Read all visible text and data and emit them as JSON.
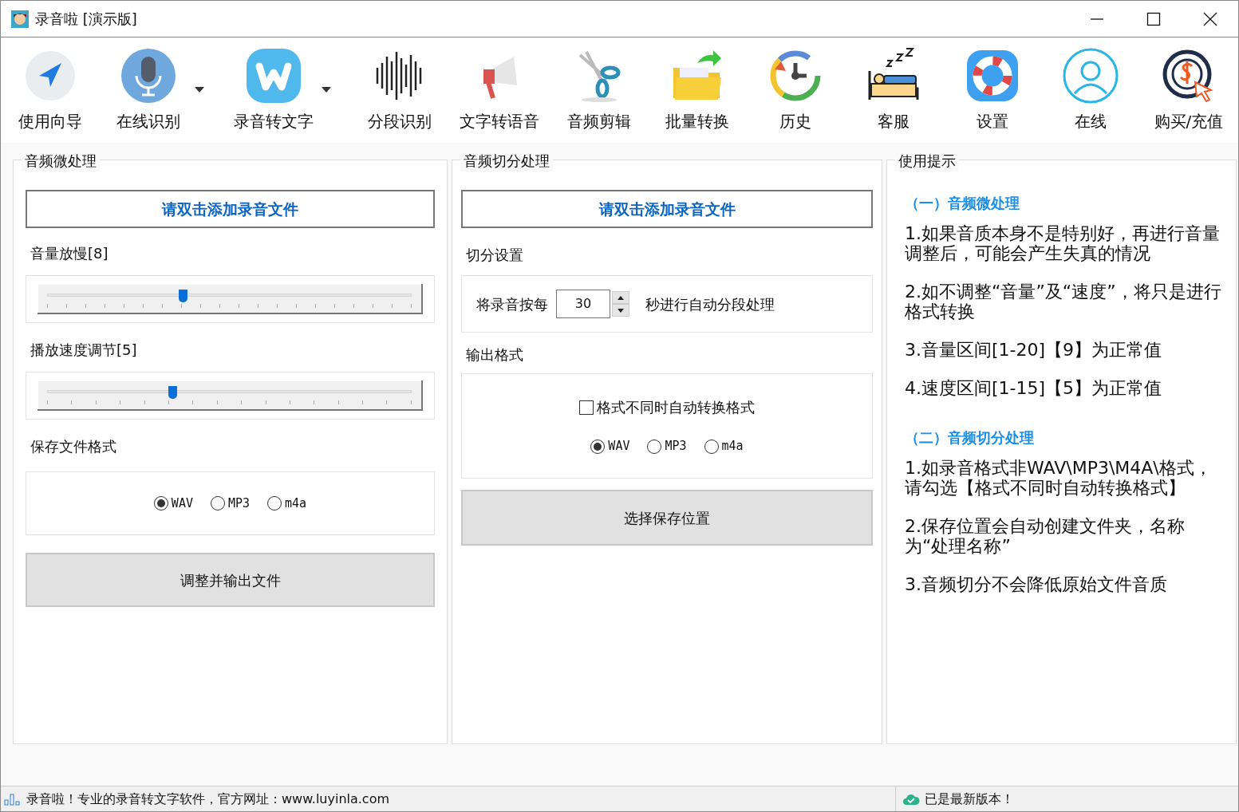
{
  "window": {
    "title": "录音啦 [演示版]"
  },
  "toolbar": [
    {
      "label": "使用向导",
      "has_menu": false
    },
    {
      "label": "在线识别",
      "has_menu": true
    },
    {
      "label": "录音转文字",
      "has_menu": true
    },
    {
      "label": "分段识别",
      "has_menu": false
    },
    {
      "label": "文字转语音",
      "has_menu": false
    },
    {
      "label": "音频剪辑",
      "has_menu": false
    },
    {
      "label": "批量转换",
      "has_menu": false
    },
    {
      "label": "历史",
      "has_menu": false
    },
    {
      "label": "客服",
      "has_menu": false
    },
    {
      "label": "设置",
      "has_menu": false
    },
    {
      "label": "在线",
      "has_menu": false
    },
    {
      "label": "购买/充值",
      "has_menu": false
    }
  ],
  "micro_panel": {
    "title": "音频微处理",
    "add_button": "请双击添加录音文件",
    "sliders": [
      {
        "label": "音量放慢[8]",
        "level": 0.37
      },
      {
        "label": "播放速度调节[5]",
        "level": 0.34
      }
    ],
    "format_label": "保存文件格式",
    "formats": [
      {
        "label": "WAV",
        "selected": true
      },
      {
        "label": "MP3",
        "selected": false
      },
      {
        "label": "m4a",
        "selected": false
      }
    ],
    "action_button": "调整并输出文件"
  },
  "split_panel": {
    "title": "音频切分处理",
    "add_button": "请双击添加录音文件",
    "settings_label": "切分设置",
    "split_prefix": "将录音按每",
    "seconds": "30",
    "split_suffix": "秒进行自动分段处理",
    "output_label": "输出格式",
    "auto_convert": {
      "label": "格式不同时自动转换格式",
      "checked": false
    },
    "formats": [
      {
        "label": "WAV",
        "selected": true
      },
      {
        "label": "MP3",
        "selected": false
      },
      {
        "label": "m4a",
        "selected": false
      }
    ],
    "action_button": "选择保存位置"
  },
  "tips_panel": {
    "title": "使用提示",
    "items": [
      {
        "kind": "heading",
        "text": "（一）音频微处理"
      },
      {
        "kind": "tip",
        "text": "1.如果音质本身不是特别好，再进行音量调整后，可能会产生失真的情况"
      },
      {
        "kind": "tip",
        "text": "2.如不调整“音量”及“速度”，将只是进行格式转换"
      },
      {
        "kind": "tip",
        "text": "3.音量区间[1-20]【9】为正常值"
      },
      {
        "kind": "tip",
        "text": "4.速度区间[1-15]【5】为正常值"
      },
      {
        "kind": "heading",
        "text": "（二）音频切分处理"
      },
      {
        "kind": "tip",
        "text": "1.如录音格式非WAV\\MP3\\M4A\\格式，请勾选【格式不同时自动转换格式】"
      },
      {
        "kind": "tip",
        "text": "2.保存位置会自动创建文件夹，名称为“处理名称”"
      },
      {
        "kind": "tip",
        "text": "3.音频切分不会降低原始文件音质"
      }
    ]
  },
  "status_bar": {
    "left": "录音啦！专业的录音转文字软件，官方网址：www.luyinla.com",
    "right": "已是最新版本！"
  }
}
